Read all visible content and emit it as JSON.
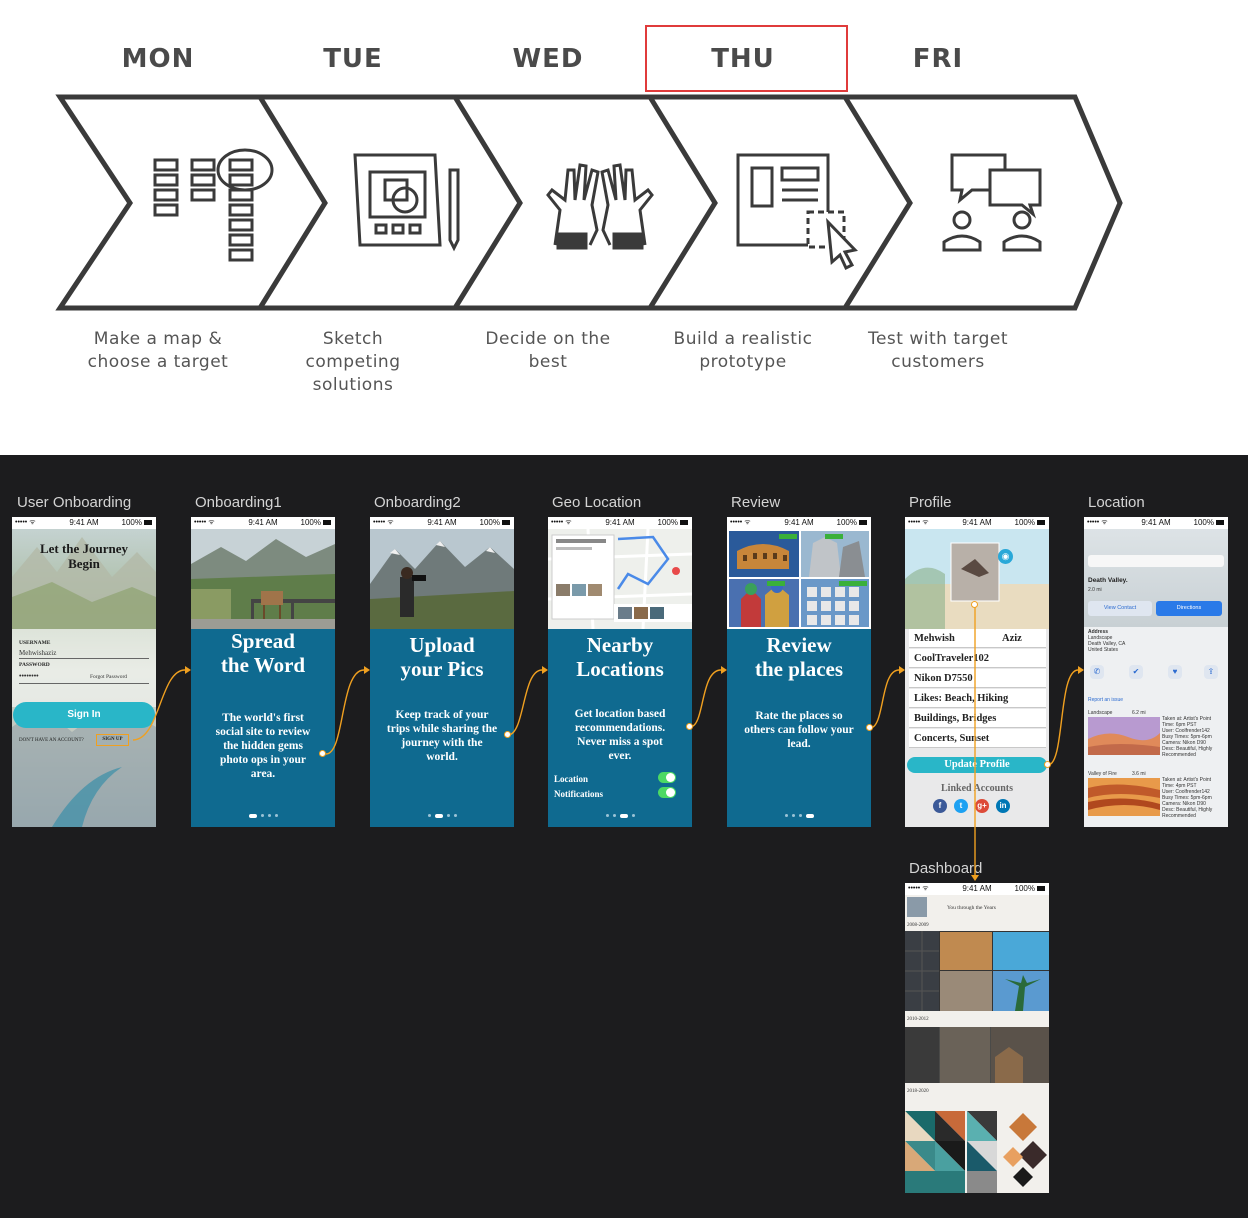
{
  "sprint": {
    "days": [
      {
        "label": "MON",
        "desc": [
          "Make a map &",
          "choose a target"
        ]
      },
      {
        "label": "TUE",
        "desc": [
          "Sketch",
          "competing",
          "solutions"
        ]
      },
      {
        "label": "WED",
        "desc": [
          "Decide on the",
          "best"
        ]
      },
      {
        "label": "THU",
        "desc": [
          "Build a realistic",
          "prototype"
        ]
      },
      {
        "label": "FRI",
        "desc": [
          "Test with target",
          "customers"
        ]
      }
    ],
    "highlighted_day": "THU",
    "icons": [
      "map-grid-icon",
      "sketch-icon",
      "raised-hands-icon",
      "prototype-icon",
      "chat-users-icon"
    ]
  },
  "status_bar": {
    "signal": "••••• ᯤ",
    "time": "9:41 AM",
    "battery": "100%"
  },
  "screens": {
    "user_onboarding": {
      "title": "User Onboarding",
      "heading_line1": "Let the Journey",
      "heading_line2": "Begin",
      "username_label": "USERNAME",
      "username_value": "Mehwishaziz",
      "password_label": "PASSWORD",
      "password_value": "••••••••",
      "forgot": "Forgot Password",
      "signin": "Sign In",
      "no_account": "DON'T HAVE AN ACCOUNT?",
      "signup": "SIGN UP"
    },
    "onboarding1": {
      "title": "Onboarding1",
      "heading": [
        "Spread",
        "the Word"
      ],
      "body": [
        "The world's first",
        "social site to review",
        "the hidden gems",
        "photo ops in your",
        "area."
      ]
    },
    "onboarding2": {
      "title": "Onboarding2",
      "heading": [
        "Upload",
        "your Pics"
      ],
      "body": [
        "Keep track of your",
        "trips while sharing the",
        "journey with the",
        "world."
      ]
    },
    "geo_location": {
      "title": "Geo Location",
      "heading": [
        "Nearby",
        "Locations"
      ],
      "body": [
        "Get location based",
        "recommendations.",
        "Never miss a spot",
        "ever."
      ],
      "toggle1": "Location",
      "toggle2": "Notifications"
    },
    "review": {
      "title": "Review",
      "heading": [
        "Review",
        "the places"
      ],
      "body": [
        "Rate the places so",
        "others can follow your",
        "lead."
      ]
    },
    "profile": {
      "title": "Profile",
      "first_name": "Mehwish",
      "last_name": "Aziz",
      "rows": [
        "CoolTraveler102",
        "Nikon D7550",
        "Likes: Beach, Hiking",
        "Buildings, Bridges",
        "Concerts, Sunset"
      ],
      "update_button": "Update Profile",
      "linked": "Linked Accounts",
      "social": [
        "f",
        "t",
        "g+",
        "in"
      ]
    },
    "location": {
      "title": "Location",
      "place": "Death Valley.",
      "distance": "2.0 mi",
      "contact": "View Contact",
      "directions": "Directions",
      "address_label": "Address",
      "address_lines": [
        "Landscape",
        "Death Valley, CA",
        "United States"
      ],
      "report": "Report an issue",
      "entries": [
        {
          "label": "Landscape",
          "size": "6.2 mi",
          "lines": [
            "Taken at: Artist's Point",
            "Time: 6pm PST",
            "User: Coolfrender142",
            "Busy Times: 5pm-6pm",
            "Camera: Nikon D90",
            "Desc: Beautiful, Highly",
            "Recommended"
          ]
        },
        {
          "label": "Valley of Fire",
          "size": "3.6 mi",
          "lines": [
            "Taken at: Artist's Point",
            "Time: 4pm PST",
            "User: Coolfrender142",
            "Busy Times: 5pm-6pm",
            "Camera: Nikon D90",
            "Desc: Beautiful, Highly",
            "Recommended"
          ]
        }
      ]
    },
    "dashboard": {
      "title": "Dashboard",
      "header": "You through the Years",
      "years": [
        "2008-2009",
        "2010-2012",
        "2018-2020"
      ]
    }
  },
  "colors": {
    "board_bg": "#1c1c1e",
    "onboard_blue": "#0f6a90",
    "connector": "#f0a020",
    "highlight_box": "#e03b3b",
    "accent_teal": "#29b6c8"
  }
}
